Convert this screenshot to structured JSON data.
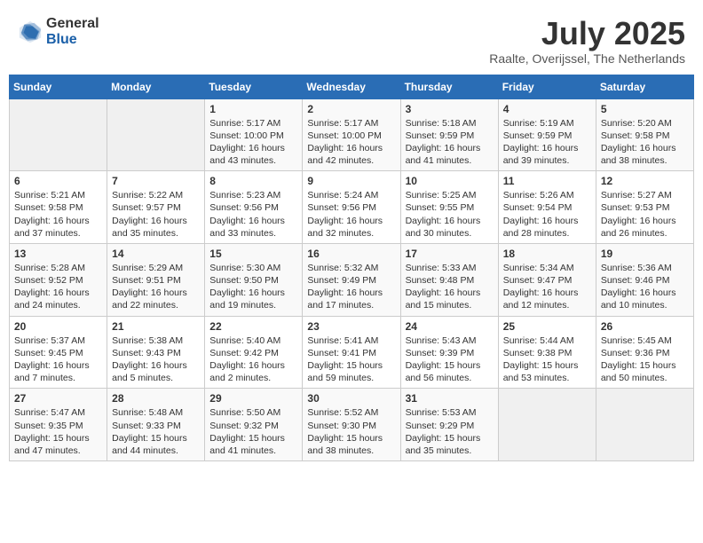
{
  "header": {
    "logo_general": "General",
    "logo_blue": "Blue",
    "month_title": "July 2025",
    "location": "Raalte, Overijssel, The Netherlands"
  },
  "weekdays": [
    "Sunday",
    "Monday",
    "Tuesday",
    "Wednesday",
    "Thursday",
    "Friday",
    "Saturday"
  ],
  "weeks": [
    [
      {
        "day": "",
        "empty": true
      },
      {
        "day": "",
        "empty": true
      },
      {
        "day": "1",
        "sunrise": "Sunrise: 5:17 AM",
        "sunset": "Sunset: 10:00 PM",
        "daylight": "Daylight: 16 hours and 43 minutes."
      },
      {
        "day": "2",
        "sunrise": "Sunrise: 5:17 AM",
        "sunset": "Sunset: 10:00 PM",
        "daylight": "Daylight: 16 hours and 42 minutes."
      },
      {
        "day": "3",
        "sunrise": "Sunrise: 5:18 AM",
        "sunset": "Sunset: 9:59 PM",
        "daylight": "Daylight: 16 hours and 41 minutes."
      },
      {
        "day": "4",
        "sunrise": "Sunrise: 5:19 AM",
        "sunset": "Sunset: 9:59 PM",
        "daylight": "Daylight: 16 hours and 39 minutes."
      },
      {
        "day": "5",
        "sunrise": "Sunrise: 5:20 AM",
        "sunset": "Sunset: 9:58 PM",
        "daylight": "Daylight: 16 hours and 38 minutes."
      }
    ],
    [
      {
        "day": "6",
        "sunrise": "Sunrise: 5:21 AM",
        "sunset": "Sunset: 9:58 PM",
        "daylight": "Daylight: 16 hours and 37 minutes."
      },
      {
        "day": "7",
        "sunrise": "Sunrise: 5:22 AM",
        "sunset": "Sunset: 9:57 PM",
        "daylight": "Daylight: 16 hours and 35 minutes."
      },
      {
        "day": "8",
        "sunrise": "Sunrise: 5:23 AM",
        "sunset": "Sunset: 9:56 PM",
        "daylight": "Daylight: 16 hours and 33 minutes."
      },
      {
        "day": "9",
        "sunrise": "Sunrise: 5:24 AM",
        "sunset": "Sunset: 9:56 PM",
        "daylight": "Daylight: 16 hours and 32 minutes."
      },
      {
        "day": "10",
        "sunrise": "Sunrise: 5:25 AM",
        "sunset": "Sunset: 9:55 PM",
        "daylight": "Daylight: 16 hours and 30 minutes."
      },
      {
        "day": "11",
        "sunrise": "Sunrise: 5:26 AM",
        "sunset": "Sunset: 9:54 PM",
        "daylight": "Daylight: 16 hours and 28 minutes."
      },
      {
        "day": "12",
        "sunrise": "Sunrise: 5:27 AM",
        "sunset": "Sunset: 9:53 PM",
        "daylight": "Daylight: 16 hours and 26 minutes."
      }
    ],
    [
      {
        "day": "13",
        "sunrise": "Sunrise: 5:28 AM",
        "sunset": "Sunset: 9:52 PM",
        "daylight": "Daylight: 16 hours and 24 minutes."
      },
      {
        "day": "14",
        "sunrise": "Sunrise: 5:29 AM",
        "sunset": "Sunset: 9:51 PM",
        "daylight": "Daylight: 16 hours and 22 minutes."
      },
      {
        "day": "15",
        "sunrise": "Sunrise: 5:30 AM",
        "sunset": "Sunset: 9:50 PM",
        "daylight": "Daylight: 16 hours and 19 minutes."
      },
      {
        "day": "16",
        "sunrise": "Sunrise: 5:32 AM",
        "sunset": "Sunset: 9:49 PM",
        "daylight": "Daylight: 16 hours and 17 minutes."
      },
      {
        "day": "17",
        "sunrise": "Sunrise: 5:33 AM",
        "sunset": "Sunset: 9:48 PM",
        "daylight": "Daylight: 16 hours and 15 minutes."
      },
      {
        "day": "18",
        "sunrise": "Sunrise: 5:34 AM",
        "sunset": "Sunset: 9:47 PM",
        "daylight": "Daylight: 16 hours and 12 minutes."
      },
      {
        "day": "19",
        "sunrise": "Sunrise: 5:36 AM",
        "sunset": "Sunset: 9:46 PM",
        "daylight": "Daylight: 16 hours and 10 minutes."
      }
    ],
    [
      {
        "day": "20",
        "sunrise": "Sunrise: 5:37 AM",
        "sunset": "Sunset: 9:45 PM",
        "daylight": "Daylight: 16 hours and 7 minutes."
      },
      {
        "day": "21",
        "sunrise": "Sunrise: 5:38 AM",
        "sunset": "Sunset: 9:43 PM",
        "daylight": "Daylight: 16 hours and 5 minutes."
      },
      {
        "day": "22",
        "sunrise": "Sunrise: 5:40 AM",
        "sunset": "Sunset: 9:42 PM",
        "daylight": "Daylight: 16 hours and 2 minutes."
      },
      {
        "day": "23",
        "sunrise": "Sunrise: 5:41 AM",
        "sunset": "Sunset: 9:41 PM",
        "daylight": "Daylight: 15 hours and 59 minutes."
      },
      {
        "day": "24",
        "sunrise": "Sunrise: 5:43 AM",
        "sunset": "Sunset: 9:39 PM",
        "daylight": "Daylight: 15 hours and 56 minutes."
      },
      {
        "day": "25",
        "sunrise": "Sunrise: 5:44 AM",
        "sunset": "Sunset: 9:38 PM",
        "daylight": "Daylight: 15 hours and 53 minutes."
      },
      {
        "day": "26",
        "sunrise": "Sunrise: 5:45 AM",
        "sunset": "Sunset: 9:36 PM",
        "daylight": "Daylight: 15 hours and 50 minutes."
      }
    ],
    [
      {
        "day": "27",
        "sunrise": "Sunrise: 5:47 AM",
        "sunset": "Sunset: 9:35 PM",
        "daylight": "Daylight: 15 hours and 47 minutes."
      },
      {
        "day": "28",
        "sunrise": "Sunrise: 5:48 AM",
        "sunset": "Sunset: 9:33 PM",
        "daylight": "Daylight: 15 hours and 44 minutes."
      },
      {
        "day": "29",
        "sunrise": "Sunrise: 5:50 AM",
        "sunset": "Sunset: 9:32 PM",
        "daylight": "Daylight: 15 hours and 41 minutes."
      },
      {
        "day": "30",
        "sunrise": "Sunrise: 5:52 AM",
        "sunset": "Sunset: 9:30 PM",
        "daylight": "Daylight: 15 hours and 38 minutes."
      },
      {
        "day": "31",
        "sunrise": "Sunrise: 5:53 AM",
        "sunset": "Sunset: 9:29 PM",
        "daylight": "Daylight: 15 hours and 35 minutes."
      },
      {
        "day": "",
        "empty": true
      },
      {
        "day": "",
        "empty": true
      }
    ]
  ]
}
